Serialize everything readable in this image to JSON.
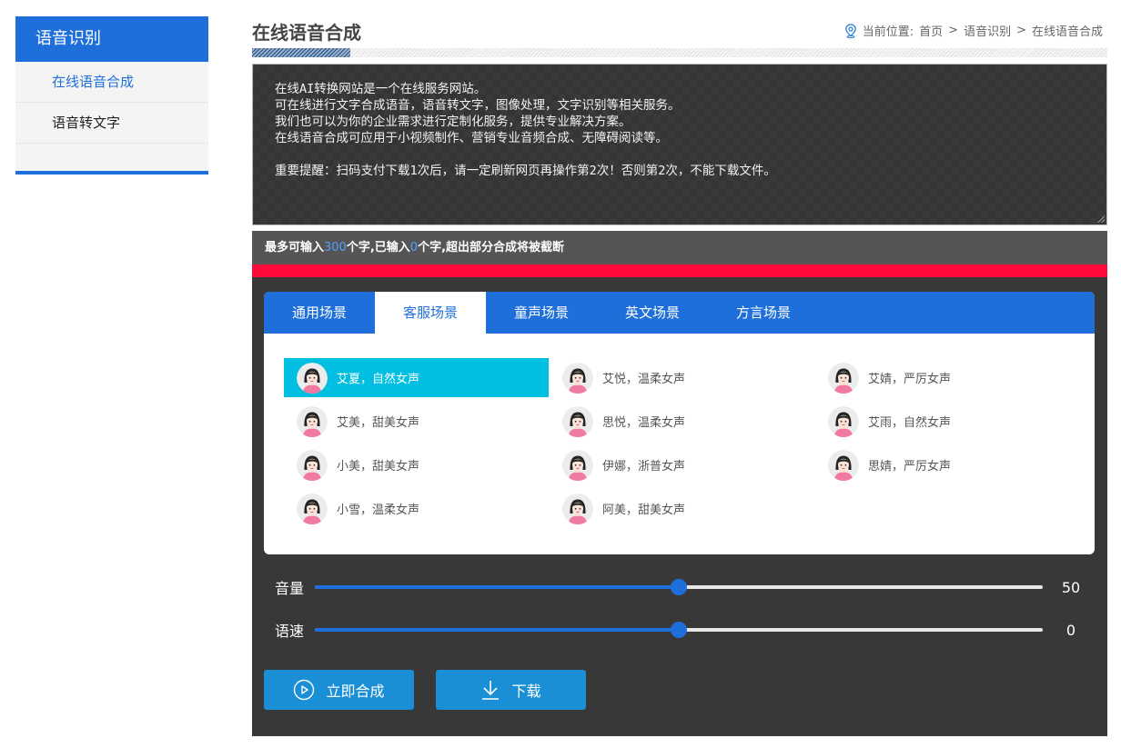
{
  "sidebar": {
    "header": "语音识别",
    "items": [
      {
        "label": "在线语音合成",
        "active": true
      },
      {
        "label": "语音转文字",
        "active": false
      }
    ]
  },
  "header": {
    "title": "在线语音合成",
    "breadcrumb_prefix": "当前位置:",
    "breadcrumb": [
      "首页",
      "语音识别",
      "在线语音合成"
    ],
    "breadcrumb_sep": ">"
  },
  "textarea": {
    "value": "在线AI转换网站是一个在线服务网站。\n可在线进行文字合成语音，语音转文字，图像处理，文字识别等相关服务。\n我们也可以为你的企业需求进行定制化服务，提供专业解决方案。\n在线语音合成可应用于小视频制作、营销专业音频合成、无障碍阅读等。\n\n重要提醒：扫码支付下载1次后，请一定刷新网页再操作第2次！否则第2次，不能下载文件。"
  },
  "counter": {
    "prefix": "最多可输入",
    "max": "300",
    "middle": "个字,已输入",
    "current": "0",
    "suffix": "个字,超出部分合成将被截断"
  },
  "tabs": [
    {
      "label": "通用场景",
      "active": false
    },
    {
      "label": "客服场景",
      "active": true
    },
    {
      "label": "童声场景",
      "active": false
    },
    {
      "label": "英文场景",
      "active": false
    },
    {
      "label": "方言场景",
      "active": false
    }
  ],
  "voices": [
    {
      "label": "艾夏，自然女声",
      "active": true
    },
    {
      "label": "艾悦，温柔女声",
      "active": false
    },
    {
      "label": "艾婧，严厉女声",
      "active": false
    },
    {
      "label": "艾美，甜美女声",
      "active": false
    },
    {
      "label": "思悦，温柔女声",
      "active": false
    },
    {
      "label": "艾雨，自然女声",
      "active": false
    },
    {
      "label": "小美，甜美女声",
      "active": false
    },
    {
      "label": "伊娜，浙普女声",
      "active": false
    },
    {
      "label": "思婧，严厉女声",
      "active": false
    },
    {
      "label": "小雪，温柔女声",
      "active": false
    },
    {
      "label": "阿美，甜美女声",
      "active": false
    }
  ],
  "sliders": {
    "volume": {
      "label": "音量",
      "value": "50",
      "fraction": 0.5
    },
    "speed": {
      "label": "语速",
      "value": "0",
      "fraction": 0.5
    }
  },
  "buttons": {
    "synthesize": "立即合成",
    "download": "下载"
  },
  "colors": {
    "primary": "#1e6fd9",
    "active_voice": "#00bfe0",
    "alert_bar": "#ff0a3a",
    "button": "#1b8fd6"
  },
  "icons": {
    "breadcrumb": "location-pin-icon",
    "synthesize": "play-circle-icon",
    "download": "download-icon",
    "avatar": "female-avatar-icon"
  }
}
